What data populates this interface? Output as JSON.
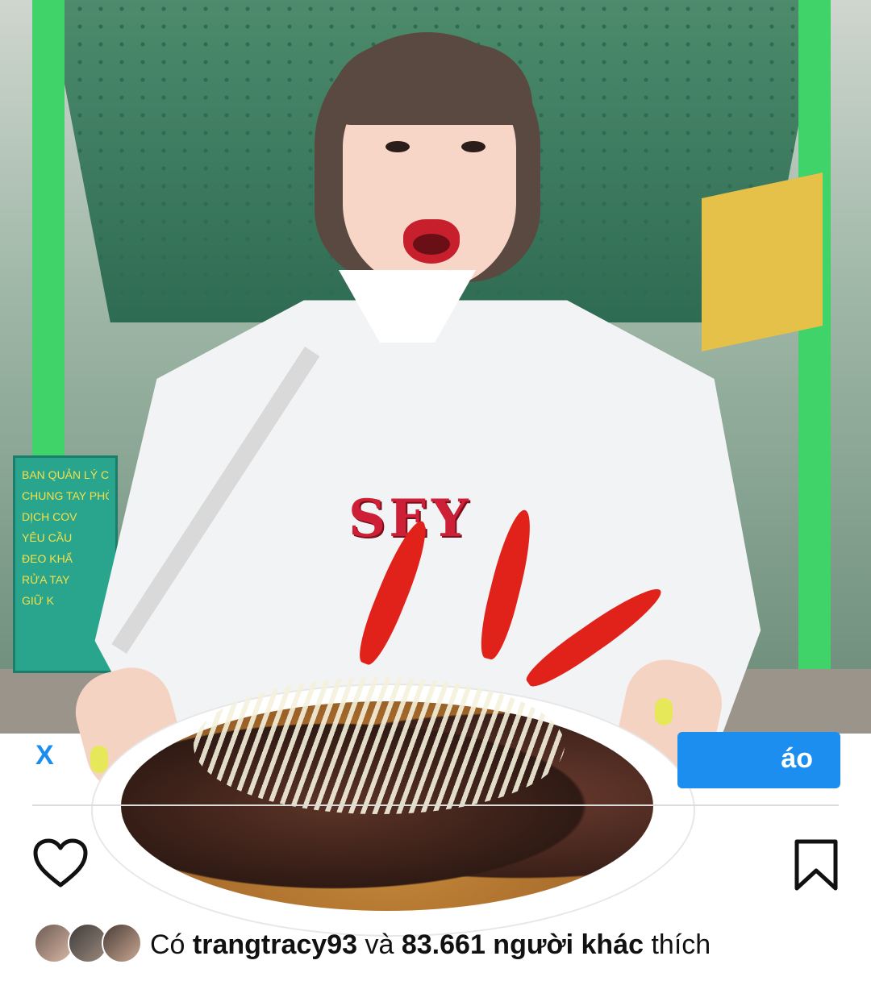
{
  "photo": {
    "sign_left_lines": [
      "BAN QUẢN LÝ CHỢ",
      "CHUNG TAY PHÒNG",
      "DỊCH COV",
      "YÊU CẦU",
      "ĐEO KHẨ",
      "RỬA TAY",
      "GIỮ K"
    ],
    "hoodie_logo": "SEY"
  },
  "post": {
    "left_cta": "X",
    "follow_button": "áo",
    "likes": {
      "prefix": "Có",
      "username": "trangtracy93",
      "connector": "và",
      "count_phrase": "83.661 người khác",
      "suffix": "thích"
    }
  },
  "icons": {
    "heart": "heart-icon",
    "bookmark": "bookmark-icon"
  },
  "colors": {
    "accent": "#1b8ef0",
    "text": "#111111",
    "divider": "#dcdcdc"
  }
}
